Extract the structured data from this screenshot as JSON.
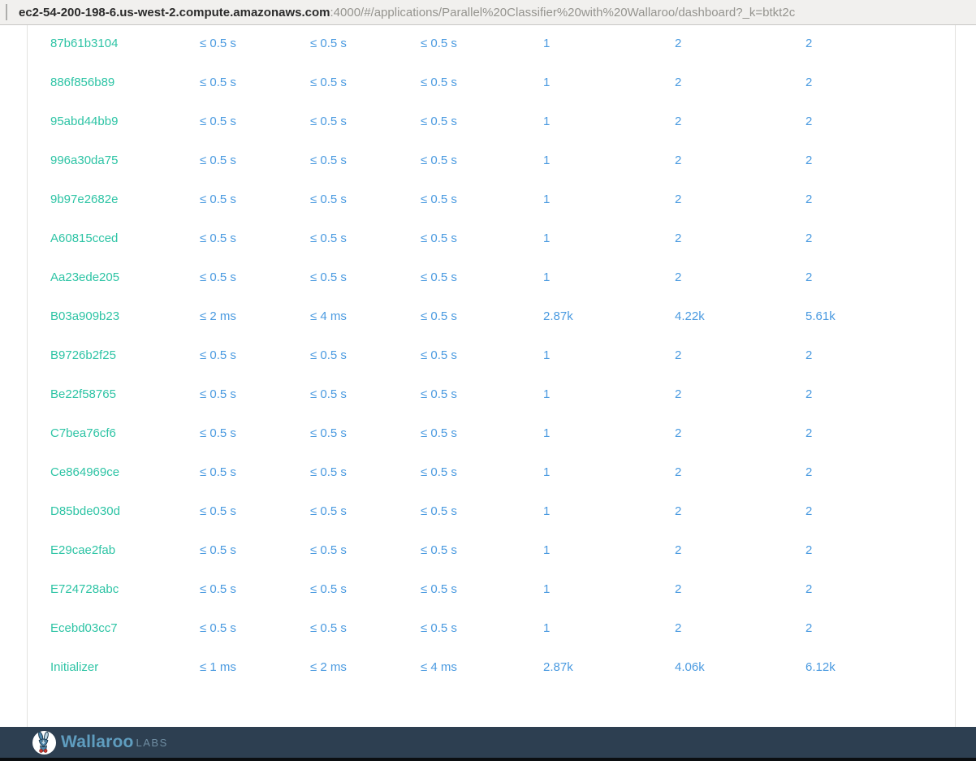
{
  "browser": {
    "url_domain": "ec2-54-200-198-6.us-west-2.compute.amazonaws.com",
    "url_path": ":4000/#/applications/Parallel%20Classifier%20with%20Wallaroo/dashboard?_k=btkt2c"
  },
  "table": {
    "rows": [
      {
        "name": "87b61b3104",
        "values": [
          "≤ 0.5 s",
          "≤ 0.5 s",
          "≤ 0.5 s",
          "1",
          "2",
          "2"
        ]
      },
      {
        "name": "886f856b89",
        "values": [
          "≤ 0.5 s",
          "≤ 0.5 s",
          "≤ 0.5 s",
          "1",
          "2",
          "2"
        ]
      },
      {
        "name": "95abd44bb9",
        "values": [
          "≤ 0.5 s",
          "≤ 0.5 s",
          "≤ 0.5 s",
          "1",
          "2",
          "2"
        ]
      },
      {
        "name": "996a30da75",
        "values": [
          "≤ 0.5 s",
          "≤ 0.5 s",
          "≤ 0.5 s",
          "1",
          "2",
          "2"
        ]
      },
      {
        "name": "9b97e2682e",
        "values": [
          "≤ 0.5 s",
          "≤ 0.5 s",
          "≤ 0.5 s",
          "1",
          "2",
          "2"
        ]
      },
      {
        "name": "A60815cced",
        "values": [
          "≤ 0.5 s",
          "≤ 0.5 s",
          "≤ 0.5 s",
          "1",
          "2",
          "2"
        ]
      },
      {
        "name": "Aa23ede205",
        "values": [
          "≤ 0.5 s",
          "≤ 0.5 s",
          "≤ 0.5 s",
          "1",
          "2",
          "2"
        ]
      },
      {
        "name": "B03a909b23",
        "values": [
          "≤ 2 ms",
          "≤ 4 ms",
          "≤ 0.5 s",
          "2.87k",
          "4.22k",
          "5.61k"
        ]
      },
      {
        "name": "B9726b2f25",
        "values": [
          "≤ 0.5 s",
          "≤ 0.5 s",
          "≤ 0.5 s",
          "1",
          "2",
          "2"
        ]
      },
      {
        "name": "Be22f58765",
        "values": [
          "≤ 0.5 s",
          "≤ 0.5 s",
          "≤ 0.5 s",
          "1",
          "2",
          "2"
        ]
      },
      {
        "name": "C7bea76cf6",
        "values": [
          "≤ 0.5 s",
          "≤ 0.5 s",
          "≤ 0.5 s",
          "1",
          "2",
          "2"
        ]
      },
      {
        "name": "Ce864969ce",
        "values": [
          "≤ 0.5 s",
          "≤ 0.5 s",
          "≤ 0.5 s",
          "1",
          "2",
          "2"
        ]
      },
      {
        "name": "D85bde030d",
        "values": [
          "≤ 0.5 s",
          "≤ 0.5 s",
          "≤ 0.5 s",
          "1",
          "2",
          "2"
        ]
      },
      {
        "name": "E29cae2fab",
        "values": [
          "≤ 0.5 s",
          "≤ 0.5 s",
          "≤ 0.5 s",
          "1",
          "2",
          "2"
        ]
      },
      {
        "name": "E724728abc",
        "values": [
          "≤ 0.5 s",
          "≤ 0.5 s",
          "≤ 0.5 s",
          "1",
          "2",
          "2"
        ]
      },
      {
        "name": "Ecebd03cc7",
        "values": [
          "≤ 0.5 s",
          "≤ 0.5 s",
          "≤ 0.5 s",
          "1",
          "2",
          "2"
        ]
      },
      {
        "name": "Initializer",
        "values": [
          "≤ 1 ms",
          "≤ 2 ms",
          "≤ 4 ms",
          "2.87k",
          "4.06k",
          "6.12k"
        ]
      }
    ]
  },
  "footer": {
    "brand": "Wallaroo",
    "brand_suffix": "LABS"
  },
  "colors": {
    "accent_green": "#2ec4a5",
    "accent_blue": "#4a9ae0",
    "footer_bg": "#2d3f51",
    "urlbar_bg": "#f1f0ee"
  }
}
